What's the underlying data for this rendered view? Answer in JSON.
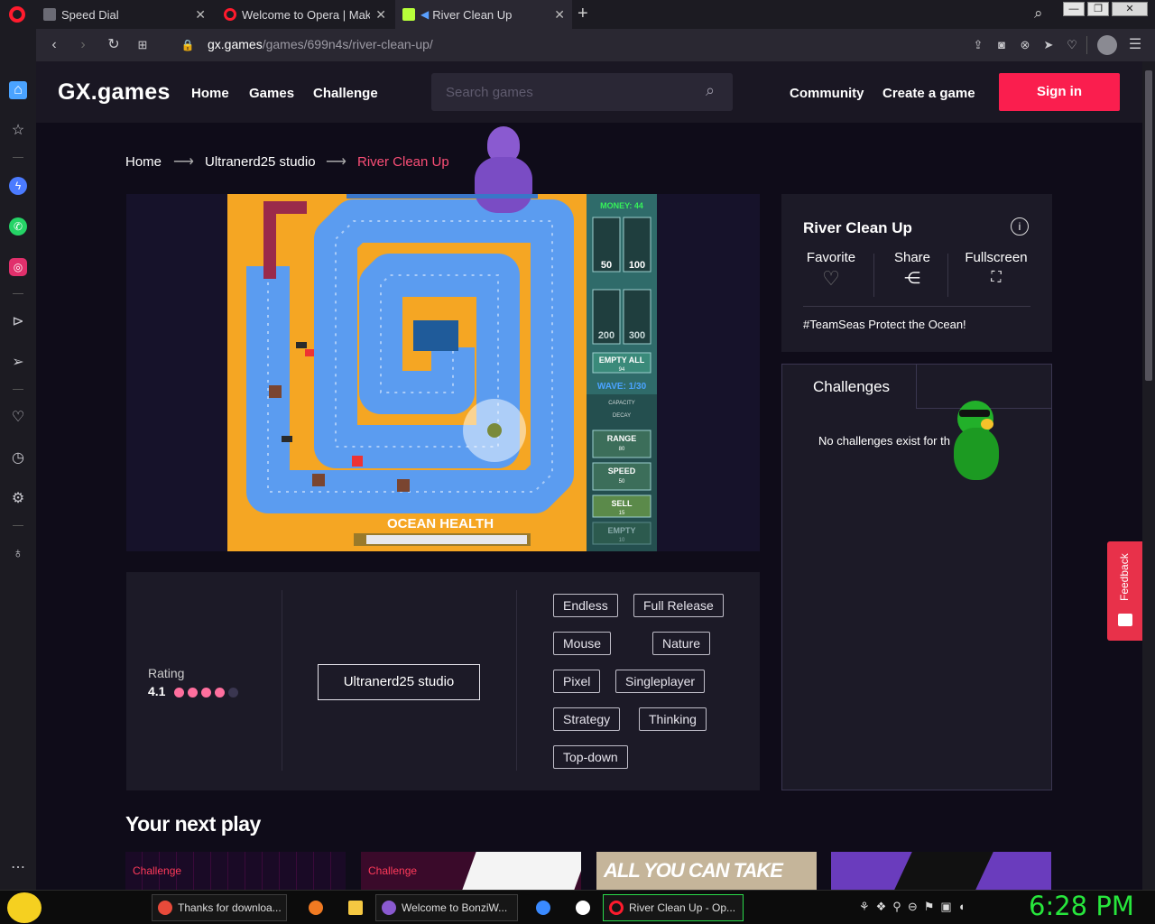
{
  "tabs": [
    {
      "label": "Speed Dial",
      "active": false
    },
    {
      "label": "Welcome to Opera | Make",
      "active": false
    },
    {
      "label": "River Clean Up",
      "active": true
    }
  ],
  "address": {
    "host": "gx.games",
    "path": "/games/699n4s/river-clean-up/"
  },
  "header": {
    "logo": "GX.games",
    "nav": [
      "Home",
      "Games",
      "Challenge"
    ],
    "search_placeholder": "Search games",
    "right_nav": [
      "Community",
      "Create a game"
    ],
    "signin": "Sign in"
  },
  "breadcrumb": {
    "home": "Home",
    "studio": "Ultranerd25 studio",
    "current": "River Clean Up",
    "current_color": "#fa4e76"
  },
  "game": {
    "money_label": "MONEY: 44",
    "tower_prices": [
      "50",
      "100",
      "200",
      "300"
    ],
    "empty_all": "EMPTY ALL",
    "empty_all_sub": "94",
    "wave": "WAVE: 1/30",
    "capacity": "CAPACITY",
    "decay": "DECAY",
    "range": "RANGE",
    "range_val": "80",
    "speed": "SPEED",
    "speed_val": "50",
    "sell": "SELL",
    "sell_val": "15",
    "empty": "EMPTY",
    "empty_val": "10",
    "ocean_health": "OCEAN HEALTH"
  },
  "info": {
    "title": "River Clean Up",
    "favorite": "Favorite",
    "share": "Share",
    "fullscreen": "Fullscreen",
    "hashtag": "#TeamSeas Protect the Ocean!"
  },
  "challenges": {
    "tab": "Challenges",
    "empty_text": "No challenges exist for th"
  },
  "meta": {
    "rating_label": "Rating",
    "rating_value": "4.1",
    "rating_fraction": 0.82,
    "studio_button": "Ultranerd25 studio",
    "tags": [
      "Endless",
      "Full Release",
      "Mouse",
      "Nature",
      "Pixel",
      "Singleplayer",
      "Strategy",
      "Thinking",
      "Top-down"
    ]
  },
  "feedback": "Feedback",
  "next_play": {
    "title": "Your next play",
    "cards": [
      {
        "badge": "Challenge"
      },
      {
        "badge": "Challenge"
      },
      {
        "badge": "ALL YOU CAN TAKE"
      },
      {
        "badge": ""
      }
    ]
  },
  "taskbar": {
    "items": [
      "Thanks for downloa...",
      "Welcome to BonziW...",
      "River Clean Up - Op..."
    ],
    "clock": "6:28 PM"
  },
  "colors": {
    "accent": "#fa1e4e",
    "sand": "#f5a623",
    "water": "#5b9cf0",
    "panel": "#1c1a27"
  }
}
